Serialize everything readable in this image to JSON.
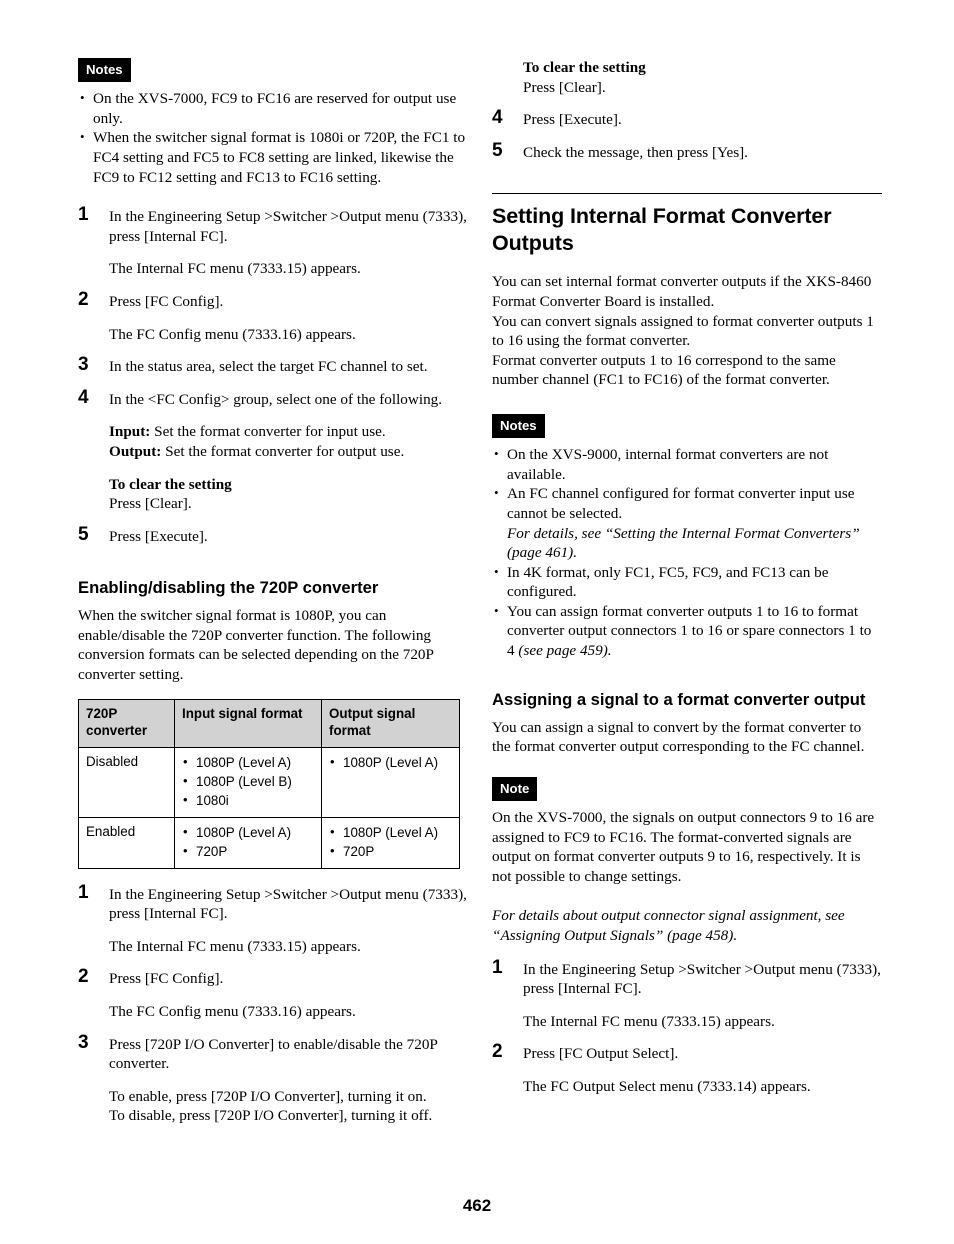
{
  "page": {
    "folio": "462"
  },
  "left_column": {
    "notes_badge": "Notes",
    "notes": [
      "On the XVS-7000, FC9 to FC16 are reserved for output use only.",
      "When the switcher signal format is 1080i or 720P, the FC1 to FC4 setting and FC5 to FC8 setting are linked, likewise the FC9 to FC12 setting and FC13 to FC16 setting."
    ],
    "steps": [
      {
        "num": "1",
        "text": "In the Engineering Setup >Switcher >Output menu (7333), press [Internal FC].",
        "result": "The Internal FC menu (7333.15) appears."
      },
      {
        "num": "2",
        "text": "Press [FC Config].",
        "result": "The FC Config menu (7333.16) appears."
      },
      {
        "num": "3",
        "text": "In the status area, select the target FC channel to set."
      },
      {
        "num": "4",
        "text": "In the <FC Config> group, select one of the following.",
        "options_input_label": "Input:",
        "options_input_text": " Set the format converter for input use.",
        "options_output_label": "Output:",
        "options_output_text": " Set the format converter for output use.",
        "clear_heading": "To clear the setting",
        "clear_text": "Press [Clear]."
      },
      {
        "num": "5",
        "text": "Press [Execute]."
      }
    ],
    "subsection": {
      "heading": "Enabling/disabling the 720P converter",
      "intro": "When the switcher signal format is 1080P, you can enable/disable the 720P converter function. The following conversion formats can be selected depending on the 720P converter setting.",
      "table": {
        "headers": [
          "720P converter",
          "Input signal format",
          "Output signal format"
        ],
        "rows": [
          {
            "converter": "Disabled",
            "input": [
              "1080P (Level A)",
              "1080P (Level B)",
              "1080i"
            ],
            "output": [
              "1080P (Level A)"
            ]
          },
          {
            "converter": "Enabled",
            "input": [
              "1080P (Level A)",
              "720P"
            ],
            "output": [
              "1080P (Level A)",
              "720P"
            ]
          }
        ]
      },
      "steps": [
        {
          "num": "1",
          "text": "In the Engineering Setup >Switcher >Output menu (7333), press [Internal FC].",
          "result": "The Internal FC menu (7333.15) appears."
        },
        {
          "num": "2",
          "text": "Press [FC Config].",
          "result": "The FC Config menu (7333.16) appears."
        },
        {
          "num": "3",
          "text": "Press [720P I/O Converter] to enable/disable the 720P converter.",
          "result_line1": "To enable, press [720P I/O Converter], turning it on.",
          "result_line2": "To disable, press [720P I/O Converter], turning it off."
        }
      ]
    }
  },
  "right_column": {
    "carryover": {
      "clear_heading": "To clear the setting",
      "clear_text": "Press [Clear].",
      "steps": [
        {
          "num": "4",
          "text": "Press [Execute]."
        },
        {
          "num": "5",
          "text": "Check the message, then press [Yes]."
        }
      ]
    },
    "section": {
      "heading": "Setting Internal Format Converter Outputs",
      "intro_lines": [
        "You can set internal format converter outputs if the XKS-8460 Format Converter Board is installed.",
        "You can convert signals assigned to format converter outputs 1 to 16 using the format converter.",
        "Format converter outputs 1 to 16 correspond to the same number channel (FC1 to FC16) of the format converter."
      ],
      "notes_badge": "Notes",
      "notes": [
        {
          "text": "On the XVS-9000, internal format converters are not available."
        },
        {
          "text": "An FC channel configured for format converter input use cannot be selected.",
          "italic_sub": "For details, see “Setting the Internal Format Converters” (page 461)."
        },
        {
          "text": "In 4K format, only FC1, FC5, FC9, and FC13 can be configured."
        },
        {
          "text": "You can assign format converter outputs 1 to 16 to format converter output connectors 1 to 16 or spare connectors 1 to 4 ",
          "italic_tail": "(see page 459)."
        }
      ]
    },
    "subsection": {
      "heading": "Assigning a signal to a format converter output",
      "intro": "You can assign a signal to convert by the format converter to the format converter output corresponding to the FC channel.",
      "note_badge": "Note",
      "note_text": "On the XVS-7000, the signals on output connectors 9 to 16 are assigned to FC9 to FC16. The format-converted signals are output on format converter outputs 9 to 16, respectively. It is not possible to change settings.",
      "reference": "For details about output connector signal assignment, see “Assigning Output Signals” (page 458).",
      "steps": [
        {
          "num": "1",
          "text": "In the Engineering Setup >Switcher >Output menu (7333), press [Internal FC].",
          "result": "The Internal FC menu (7333.15) appears."
        },
        {
          "num": "2",
          "text": "Press [FC Output Select].",
          "result": "The FC Output Select menu (7333.14) appears."
        }
      ]
    }
  }
}
